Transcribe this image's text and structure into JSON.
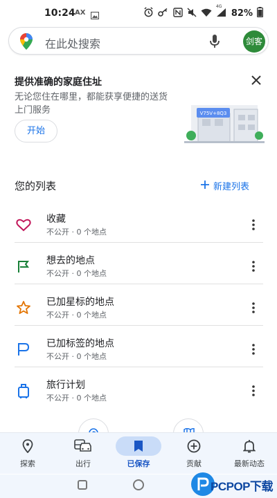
{
  "status_bar": {
    "time": "10:24",
    "carrier_tag": "AX",
    "signal_tag": "4G",
    "battery": "82%"
  },
  "search": {
    "placeholder": "在此处搜索",
    "avatar_text": "剑客"
  },
  "promo": {
    "title": "提供准确的家庭住址",
    "description": "无论您住在哪里，都能获享便捷的送货上门服务",
    "button": "开始",
    "illustration_text": "V75V+8Q3"
  },
  "lists": {
    "title": "您的列表",
    "new_list": "新建列表",
    "items": [
      {
        "title": "收藏",
        "subtitle": "不公开 · 0 个地点",
        "icon": "heart-icon",
        "color": "#c2185b"
      },
      {
        "title": "想去的地点",
        "subtitle": "不公开 · 0 个地点",
        "icon": "flag-icon",
        "color": "#188038"
      },
      {
        "title": "已加星标的地点",
        "subtitle": "不公开 · 0 个地点",
        "icon": "star-icon",
        "color": "#e37400"
      },
      {
        "title": "已加标签的地点",
        "subtitle": "不公开 · 0 个地点",
        "icon": "label-flag-icon",
        "color": "#1a73e8"
      },
      {
        "title": "旅行计划",
        "subtitle": "不公开 · 0 个地点",
        "icon": "luggage-icon",
        "color": "#1a73e8"
      }
    ]
  },
  "bottom_nav": {
    "items": [
      {
        "label": "探索",
        "icon": "location-pin-icon",
        "active": false
      },
      {
        "label": "出行",
        "icon": "car-bus-icon",
        "active": false
      },
      {
        "label": "已保存",
        "icon": "bookmark-icon",
        "active": true
      },
      {
        "label": "贡献",
        "icon": "add-circle-icon",
        "active": false
      },
      {
        "label": "最新动态",
        "icon": "bell-icon",
        "active": false
      }
    ]
  },
  "watermark": {
    "text": "PCPOP下载"
  },
  "colors": {
    "accent": "#1a73e8",
    "active_nav": "#1a56c4",
    "avatar": "#2e8b3a"
  }
}
